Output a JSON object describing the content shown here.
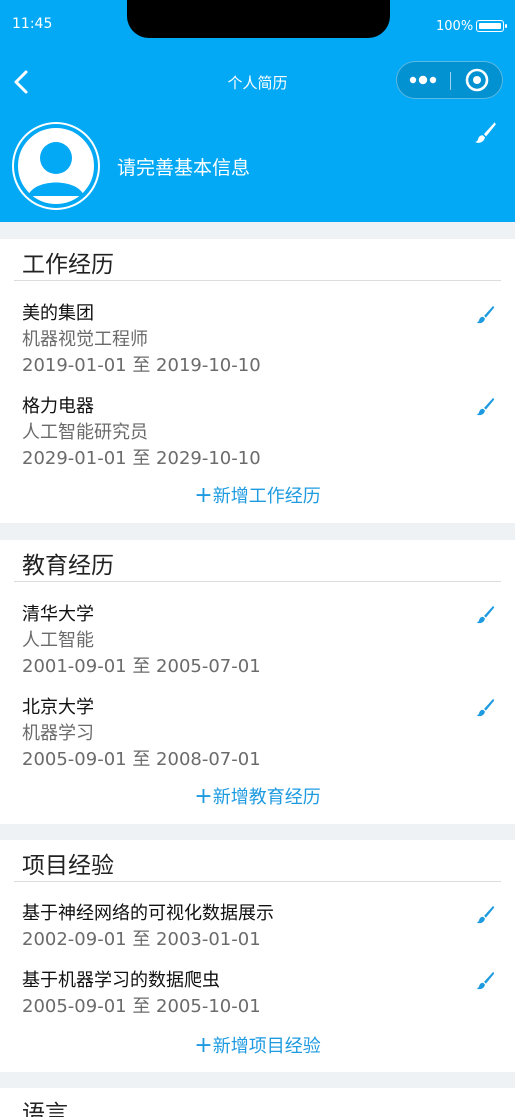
{
  "status": {
    "time": "11:45",
    "battery": "100%"
  },
  "nav": {
    "title": "个人简历"
  },
  "profile": {
    "prompt": "请完善基本信息"
  },
  "work": {
    "title": "工作经历",
    "entries": [
      {
        "name": "美的集团",
        "role": "机器视觉工程师",
        "date": "2019-01-01 至 2019-10-10"
      },
      {
        "name": "格力电器",
        "role": "人工智能研究员",
        "date": "2029-01-01 至 2029-10-10"
      }
    ],
    "add_plus": "+",
    "add_label": "新增工作经历"
  },
  "education": {
    "title": "教育经历",
    "entries": [
      {
        "name": "清华大学",
        "major": "人工智能",
        "date": "2001-09-01 至 2005-07-01"
      },
      {
        "name": "北京大学",
        "major": "机器学习",
        "date": "2005-09-01 至 2008-07-01"
      }
    ],
    "add_plus": "+",
    "add_label": "新增教育经历"
  },
  "projects": {
    "title": "项目经验",
    "entries": [
      {
        "name": "基于神经网络的可视化数据展示",
        "date": "2002-09-01 至 2003-01-01"
      },
      {
        "name": "基于机器学习的数据爬虫",
        "date": "2005-09-01 至 2005-10-01"
      }
    ],
    "add_plus": "+",
    "add_label": "新增项目经验"
  },
  "language": {
    "title": "语言"
  },
  "colors": {
    "primary": "#03a9f4",
    "accent": "#1e9be0"
  }
}
